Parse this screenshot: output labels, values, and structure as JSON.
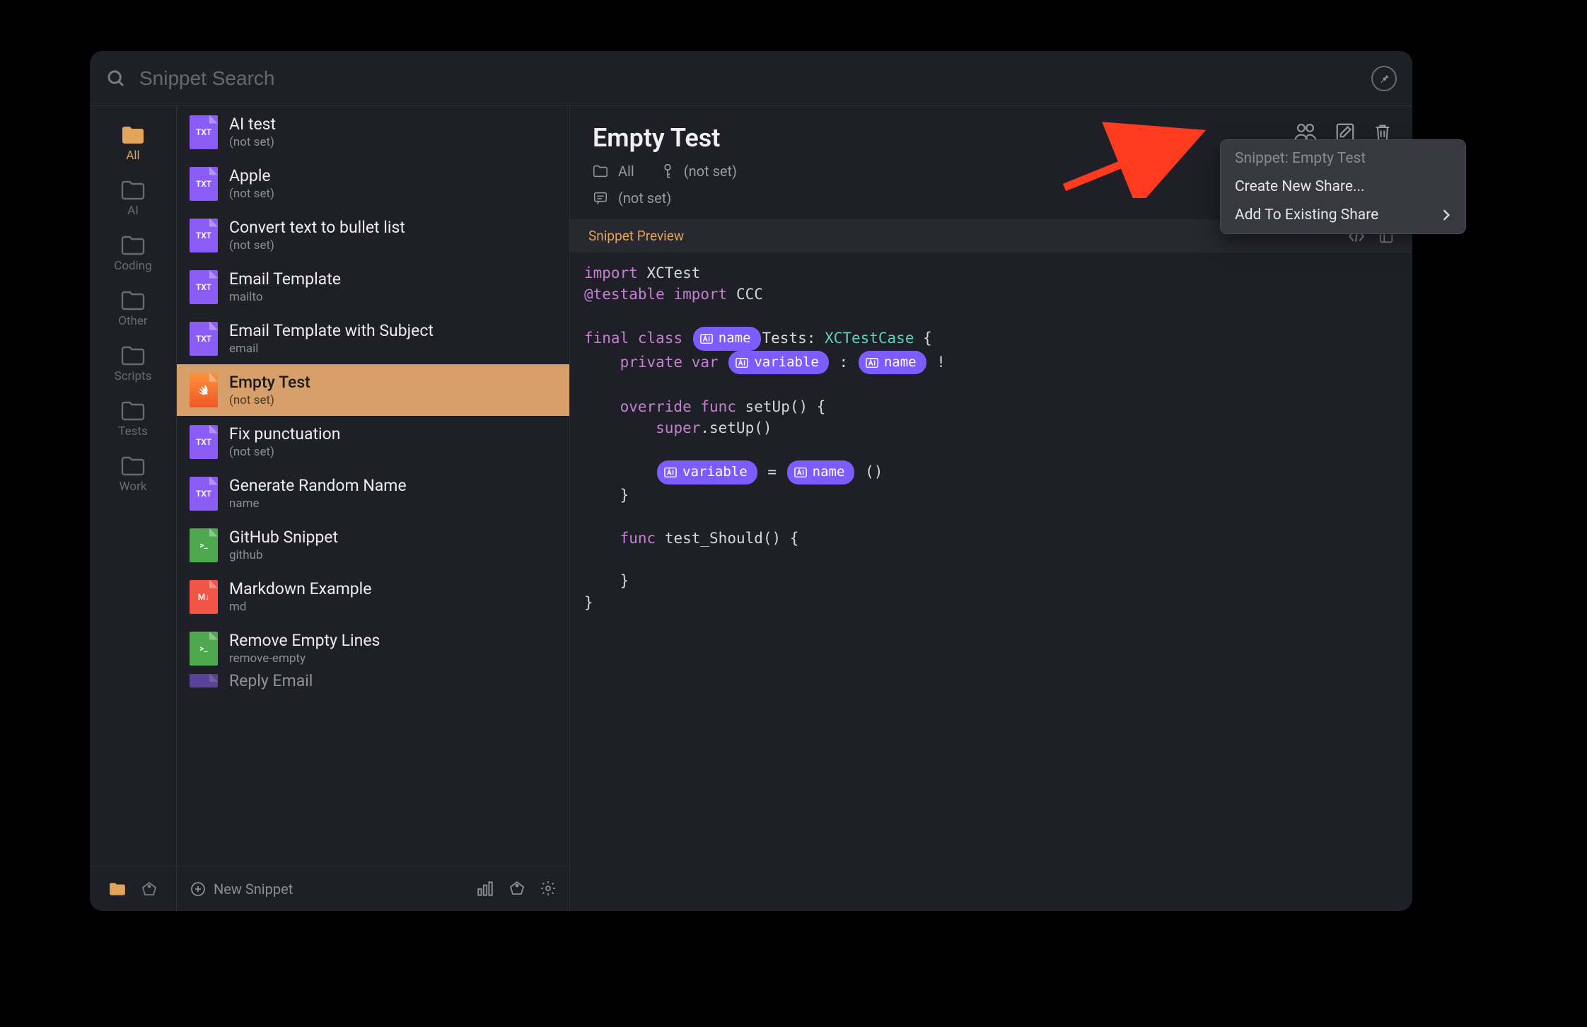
{
  "search": {
    "placeholder": "Snippet Search"
  },
  "folders": [
    {
      "label": "All",
      "active": true
    },
    {
      "label": "AI"
    },
    {
      "label": "Coding"
    },
    {
      "label": "Other"
    },
    {
      "label": "Scripts"
    },
    {
      "label": "Tests"
    },
    {
      "label": "Work"
    }
  ],
  "snippets": [
    {
      "title": "AI test",
      "sub": "(not set)",
      "icon": "txt"
    },
    {
      "title": "Apple",
      "sub": "(not set)",
      "icon": "txt"
    },
    {
      "title": "Convert text to bullet list",
      "sub": "(not set)",
      "icon": "txt"
    },
    {
      "title": "Email Template",
      "sub": "mailto",
      "icon": "txt"
    },
    {
      "title": "Email Template with Subject",
      "sub": "email",
      "icon": "txt"
    },
    {
      "title": "Empty Test",
      "sub": "(not set)",
      "icon": "swift",
      "selected": true
    },
    {
      "title": "Fix punctuation",
      "sub": "(not set)",
      "icon": "txt"
    },
    {
      "title": "Generate Random Name",
      "sub": "name",
      "icon": "txt"
    },
    {
      "title": "GitHub Snippet",
      "sub": "github",
      "icon": "sh"
    },
    {
      "title": "Markdown Example",
      "sub": "md",
      "icon": "md"
    },
    {
      "title": "Remove Empty Lines",
      "sub": "remove-empty",
      "icon": "sh"
    },
    {
      "title": "Reply Email",
      "sub": "",
      "icon": "txt"
    }
  ],
  "new_snippet_label": "New Snippet",
  "detail": {
    "title": "Empty Test",
    "folder_label": "All",
    "keyword": "(not set)",
    "description": "(not set)",
    "preview_label": "Snippet Preview"
  },
  "code": {
    "import_kw": "import",
    "import_mod": "XCTest",
    "testable": "@testable",
    "import2": "import",
    "ccc": "CCC",
    "final": "final",
    "class": "class",
    "chip_name": "name",
    "tests_suffix": "Tests:",
    "xctestcase": "XCTestCase",
    "brace_open": "{",
    "private": "private",
    "var": "var",
    "chip_variable": "variable",
    "colon": ":",
    "chip_name2": "name",
    "bang": "!",
    "override": "override",
    "func": "func",
    "setup": "setUp()",
    "brace_o2": "{",
    "super_kw": "super",
    "dot_setup": ".setUp()",
    "chip_variable2": "variable",
    "eq": "=",
    "chip_name3": "name",
    "parens": "()",
    "brace_c1": "}",
    "func2": "func",
    "test_should": "test_Should()",
    "brace_o3": "{",
    "brace_c2": "}",
    "brace_c3": "}"
  },
  "context_menu": {
    "title": "Snippet: Empty Test",
    "create": "Create New Share...",
    "add": "Add To Existing Share"
  },
  "icon_labels": {
    "txt": "TXT",
    "swift": "",
    "sh": ">_",
    "md": "M↓"
  }
}
